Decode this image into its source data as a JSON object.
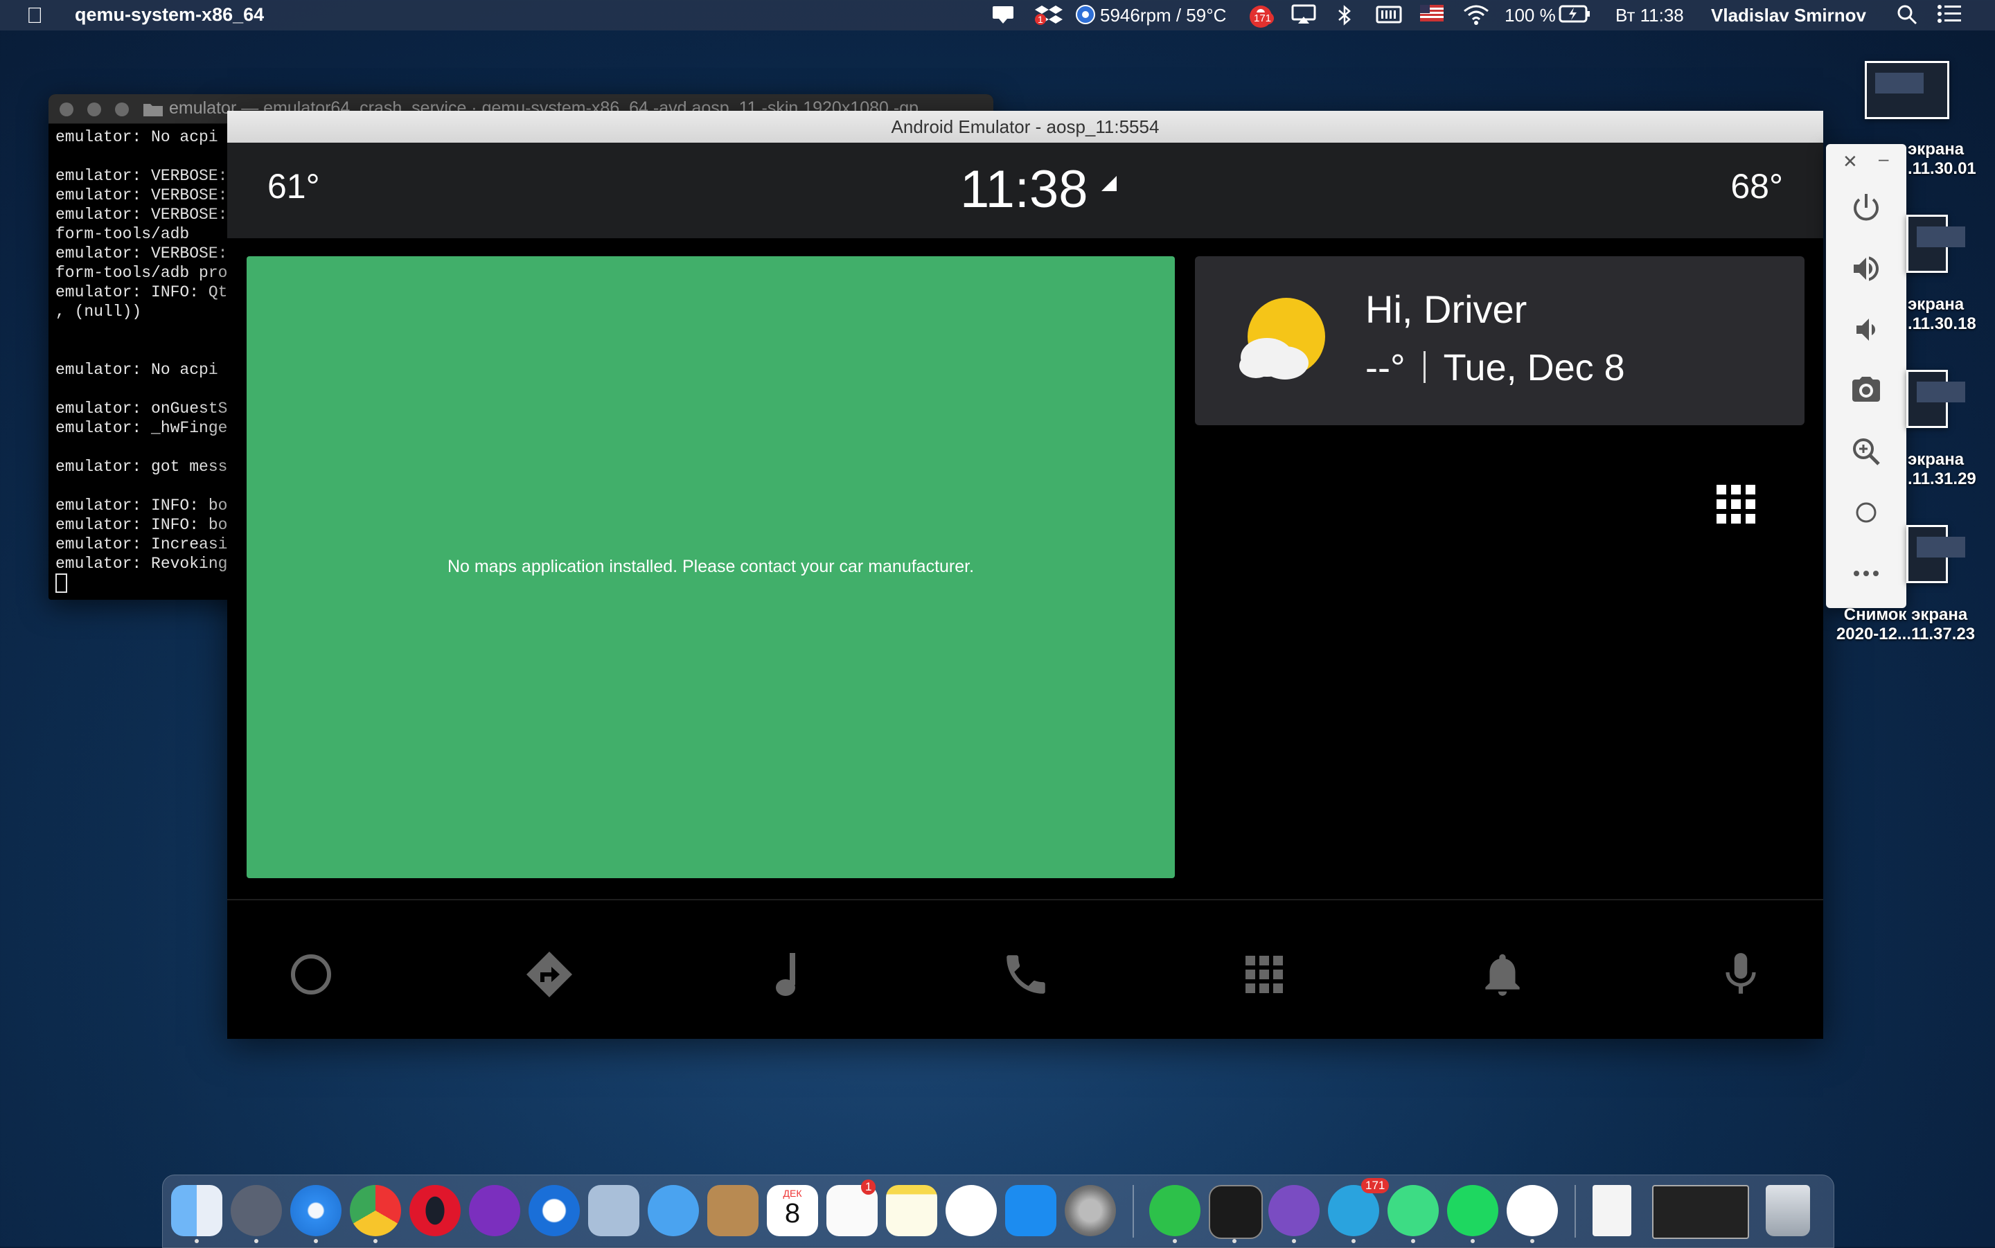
{
  "menubar": {
    "app_name": "qemu-system-x86_64",
    "sensor_text": "5946rpm / 59°C",
    "notification_count": "171",
    "battery": "100 %",
    "clock": "Вт 11:38",
    "user": "Vladislav Smirnov",
    "dropbox_badge": "1"
  },
  "terminal": {
    "title": "emulator — emulator64_crash_service · qemu-system-x86_64 -avd aosp_11 -skin 1920x1080 -gp",
    "lines": [
      "emulator: No acpi",
      "",
      "emulator: VERBOSE:",
      "emulator: VERBOSE:",
      "emulator: VERBOSE:",
      "form-tools/adb",
      "emulator: VERBOSE:",
      "form-tools/adb pro",
      "emulator: INFO: Qt",
      ", (null))",
      "",
      "",
      "emulator: No acpi",
      "",
      "emulator: onGuestS",
      "emulator: _hwFinge",
      "",
      "emulator: got mess",
      "",
      "emulator: INFO: bo",
      "emulator: INFO: bo",
      "emulator: Increasi",
      "emulator: Revoking"
    ]
  },
  "emulator": {
    "window_title": "Android Emulator - aosp_11:5554",
    "status": {
      "temp_left": "61°",
      "clock": "11:38",
      "temp_right": "68°"
    },
    "map_message": "No maps application installed. Please contact your car manufacturer.",
    "weather": {
      "greeting": "Hi, Driver",
      "temp": "--°",
      "date": "Tue, Dec 8"
    }
  },
  "desktop_icons": [
    {
      "line1": "экрана",
      "line2": ".11.30.01"
    },
    {
      "line1": "экрана",
      "line2": ".11.30.18"
    },
    {
      "line1": "экрана",
      "line2": ".11.31.29"
    },
    {
      "line1": "Снимок экрана",
      "line2": "2020-12...11.37.23"
    }
  ],
  "dock": {
    "calendar_month": "ДЕК",
    "calendar_day": "8",
    "reminders_badge": "1",
    "telegram_badge": "171"
  },
  "colors": {
    "map_green": "#41af6a",
    "status_bar": "#1e1f21",
    "weather_card": "#2b2b2f",
    "nav_icon": "#666666",
    "badge_red": "#e2312f"
  }
}
